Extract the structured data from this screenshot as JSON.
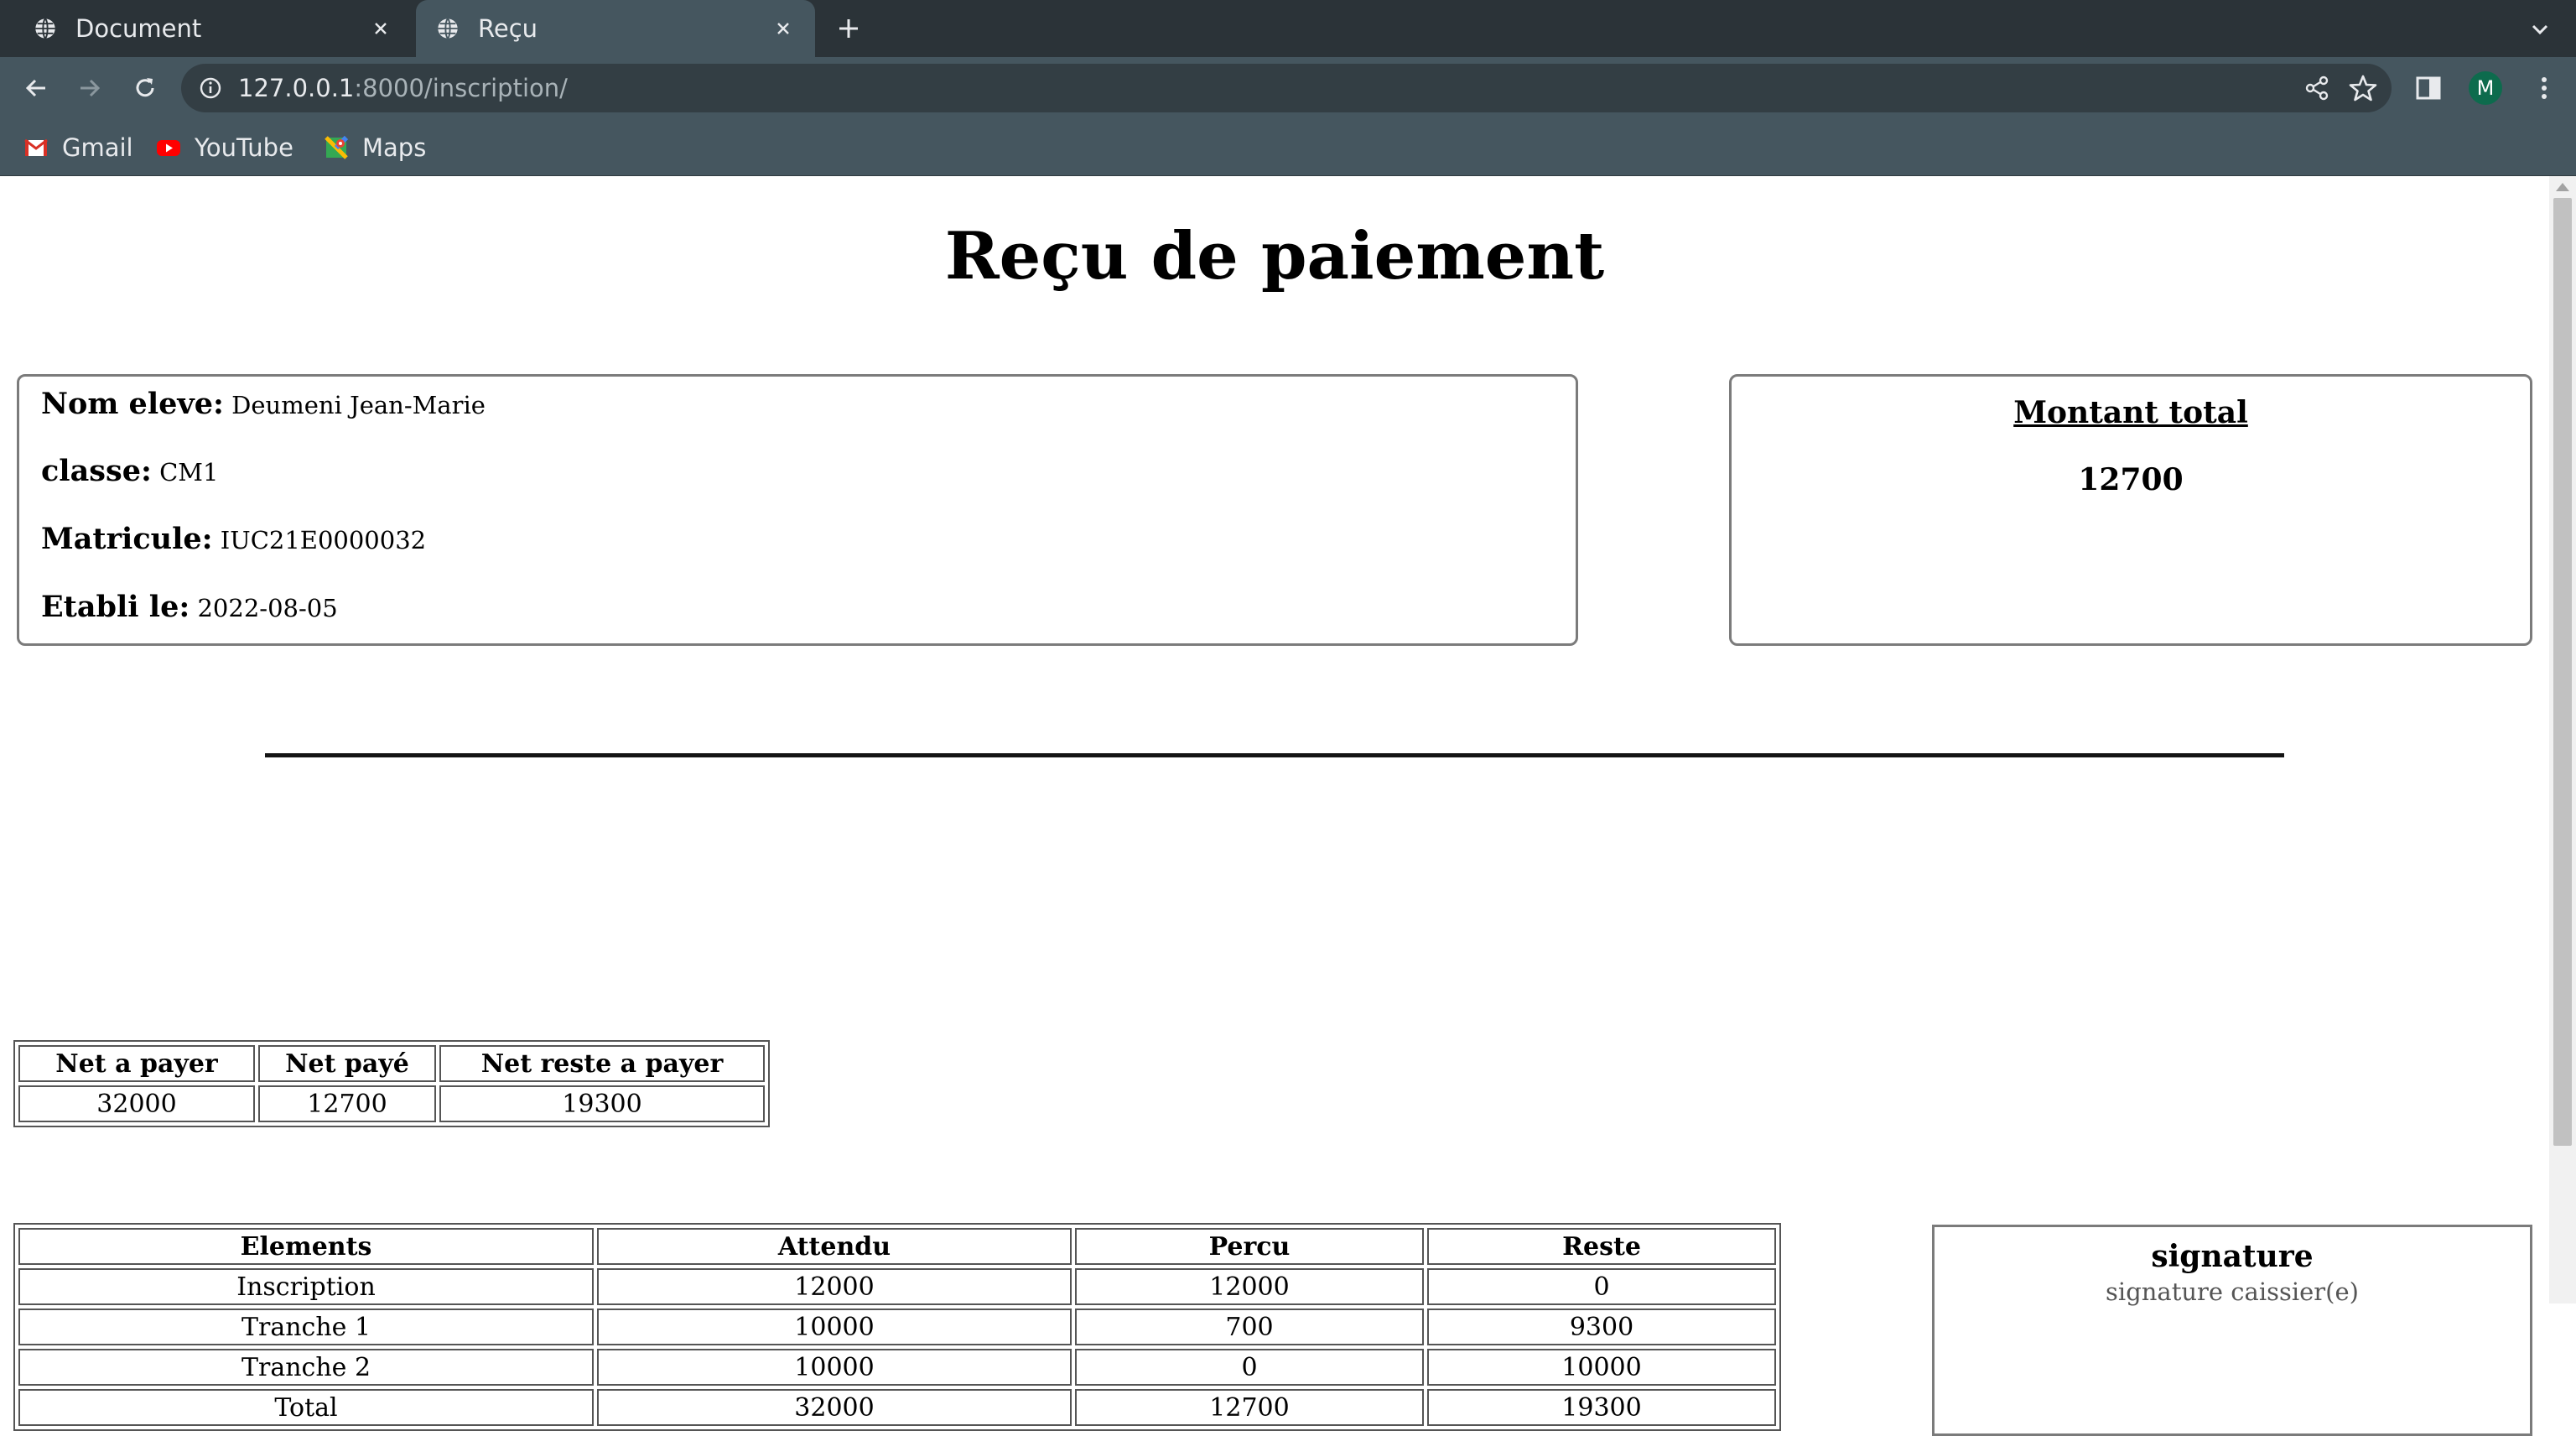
{
  "browser": {
    "tabs": [
      {
        "title": "Document",
        "active": false
      },
      {
        "title": "Reçu",
        "active": true
      }
    ],
    "url_host": "127.0.0.1",
    "url_rest": ":8000/inscription/",
    "profile_initial": "M",
    "bookmarks": [
      {
        "label": "Gmail",
        "icon": "gmail-icon"
      },
      {
        "label": "YouTube",
        "icon": "youtube-icon"
      },
      {
        "label": "Maps",
        "icon": "maps-icon"
      }
    ]
  },
  "receipt": {
    "title": "Reçu de paiement",
    "student": {
      "name_label": "Nom eleve:",
      "name_value": "Deumeni Jean-Marie",
      "class_label": "classe:",
      "class_value": "CM1",
      "id_label": "Matricule:",
      "id_value": "IUC21E0000032",
      "date_label": "Etabli le:",
      "date_value": "2022-08-05"
    },
    "total": {
      "label": "Montant total",
      "value": "12700"
    },
    "summary": {
      "headers": [
        "Net a payer",
        "Net payé",
        "Net reste a payer"
      ],
      "values": [
        "32000",
        "12700",
        "19300"
      ]
    },
    "elements": {
      "headers": [
        "Elements",
        "Attendu",
        "Percu",
        "Reste"
      ],
      "rows": [
        [
          "Inscription",
          "12000",
          "12000",
          "0"
        ],
        [
          "Tranche 1",
          "10000",
          "700",
          "9300"
        ],
        [
          "Tranche 2",
          "10000",
          "0",
          "10000"
        ],
        [
          "Total",
          "32000",
          "12700",
          "19300"
        ]
      ]
    },
    "signature": {
      "title": "signature",
      "caption": "signature caissier(e)"
    }
  }
}
